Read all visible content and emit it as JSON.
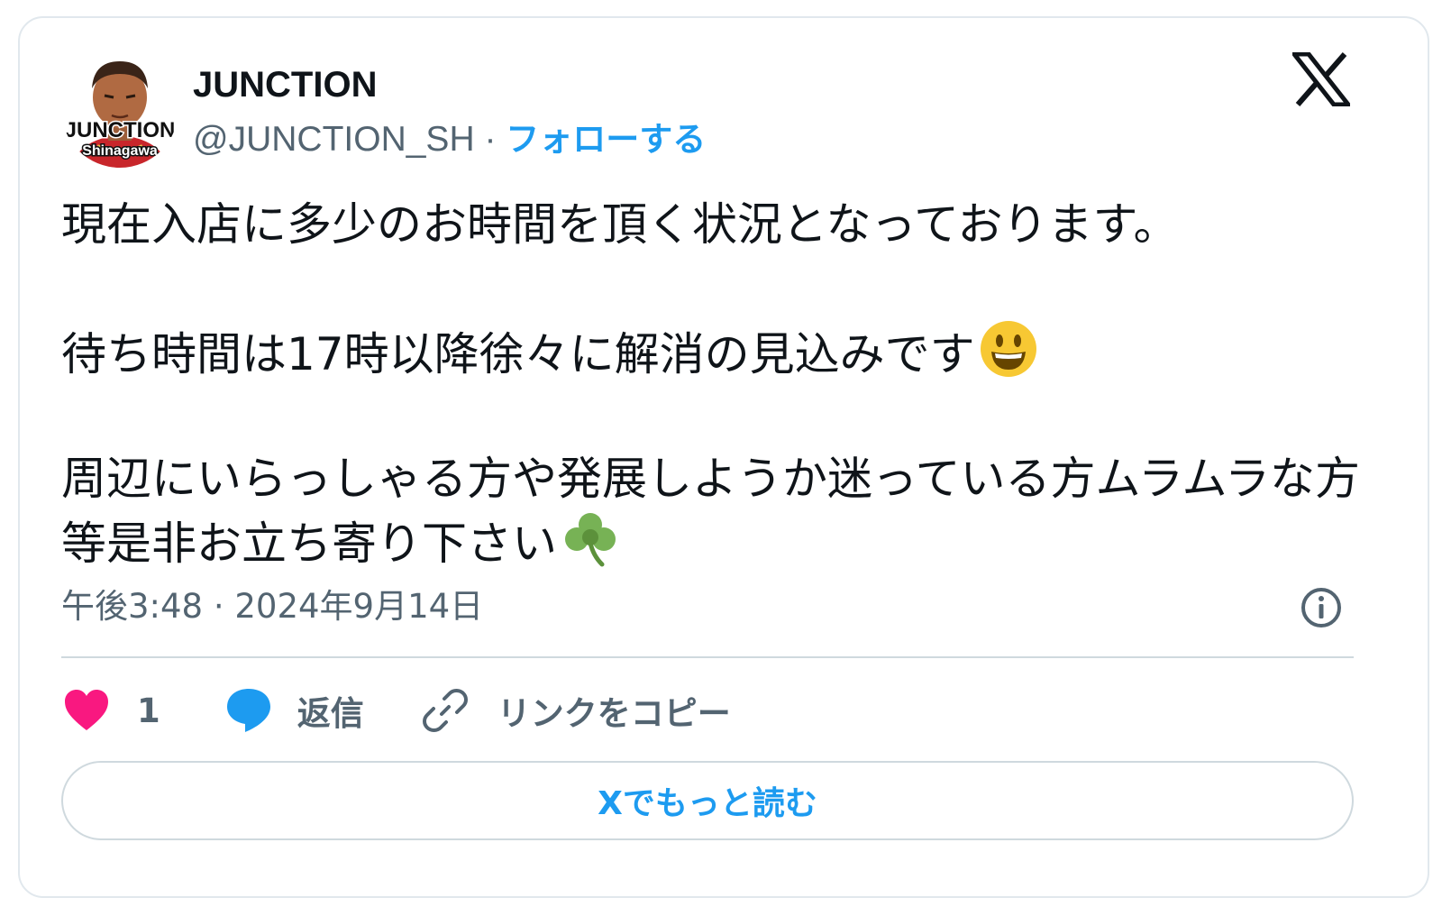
{
  "author": {
    "display_name": "JUNCTION",
    "handle": "@JUNCTION_SH",
    "separator": " · ",
    "follow_label": "フォローする",
    "avatar_text_line1": "JUNCTION",
    "avatar_text_line2": "Shinagawa"
  },
  "tweet": {
    "paragraphs": [
      "現在入店に多少のお時間を頂く状況となっております。",
      "待ち時間は17時以降徐々に解消の見込みです",
      "周辺にいらっしゃる方や発展しようか迷っている方ムラムラな方等是非お立ち寄り下さい"
    ],
    "emojis": [
      "smiling-face-emoji",
      "shamrock-emoji"
    ],
    "timestamp": "午後3:48 · 2024年9月14日"
  },
  "actions": {
    "like_count": "1",
    "reply_label": "返信",
    "copy_link_label": "リンクをコピー"
  },
  "read_more_label": "Xでもっと読む",
  "icons": {
    "platform": "x-logo-icon",
    "info": "info-icon",
    "like": "heart-icon",
    "reply": "speech-bubble-icon",
    "copy": "link-icon"
  },
  "colors": {
    "link_blue": "#1d9bf0",
    "heart_pink": "#f91880",
    "text_primary": "#0f1419",
    "text_secondary": "#536471",
    "border": "#cfd9de"
  }
}
